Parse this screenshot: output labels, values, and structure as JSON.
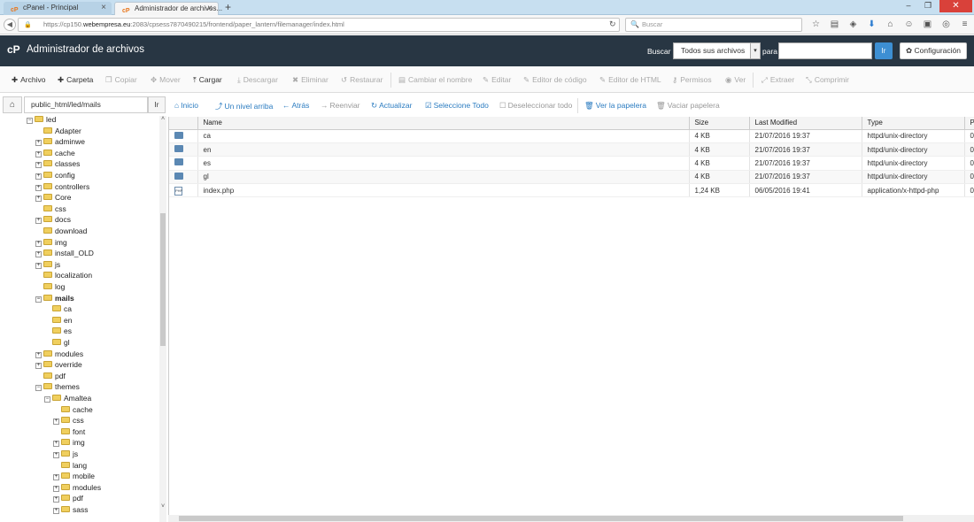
{
  "browser": {
    "tabs": [
      {
        "label": "cPanel - Principal",
        "active": false
      },
      {
        "label": "Administrador de archivos...",
        "active": true
      }
    ],
    "url_prefix": "https://cp150.",
    "url_host": "webempresa.eu",
    "url_rest": ":2083/cpsess7870490215/frontend/paper_lantern/filemanager/index.html",
    "search_placeholder": "Buscar"
  },
  "header": {
    "title": "Administrador de archivos",
    "search_label": "Buscar",
    "search_scope": "Todos sus archivos",
    "for_label": "para",
    "go_label": "Ir",
    "settings_label": "Configuración"
  },
  "toolbar": [
    {
      "label": "Archivo",
      "icon": "plus-icon",
      "enabled": true
    },
    {
      "label": "Carpeta",
      "icon": "plus-icon",
      "enabled": true
    },
    {
      "label": "Copiar",
      "icon": "copy-icon",
      "enabled": false
    },
    {
      "label": "Mover",
      "icon": "move-icon",
      "enabled": false
    },
    {
      "label": "Cargar",
      "icon": "upload-icon",
      "enabled": true
    },
    {
      "label": "Descargar",
      "icon": "download-icon",
      "enabled": false
    },
    {
      "label": "Eliminar",
      "icon": "delete-icon",
      "enabled": false
    },
    {
      "label": "Restaurar",
      "icon": "restore-icon",
      "enabled": false
    },
    {
      "label": "Cambiar el nombre",
      "icon": "rename-icon",
      "enabled": false
    },
    {
      "label": "Editar",
      "icon": "pencil-icon",
      "enabled": false
    },
    {
      "label": "Editor de código",
      "icon": "code-editor-icon",
      "enabled": false
    },
    {
      "label": "Editor de HTML",
      "icon": "html-editor-icon",
      "enabled": false
    },
    {
      "label": "Permisos",
      "icon": "key-icon",
      "enabled": false
    },
    {
      "label": "Ver",
      "icon": "eye-icon",
      "enabled": false
    },
    {
      "label": "Extraer",
      "icon": "extract-icon",
      "enabled": false
    },
    {
      "label": "Comprimir",
      "icon": "compress-icon",
      "enabled": false
    }
  ],
  "path": {
    "value": "public_html/led/mails",
    "go_label": "Ir"
  },
  "actions": [
    {
      "label": "Inicio",
      "enabled": true
    },
    {
      "label": "Un nivel arriba",
      "enabled": true
    },
    {
      "label": "Atrás",
      "enabled": true
    },
    {
      "label": "Reenviar",
      "enabled": false
    },
    {
      "label": "Actualizar",
      "enabled": true
    },
    {
      "label": "Seleccione Todo",
      "enabled": true
    },
    {
      "label": "Deseleccionar todo",
      "enabled": false
    },
    {
      "label": "Ver la papelera",
      "enabled": true
    },
    {
      "label": "Vaciar papelera",
      "enabled": false
    }
  ],
  "tree": [
    {
      "label": "led",
      "level": 0,
      "expander": "−",
      "bold": false
    },
    {
      "label": "Adapter",
      "level": 1,
      "expander": "",
      "bold": false
    },
    {
      "label": "adminwe",
      "level": 1,
      "expander": "+",
      "bold": false
    },
    {
      "label": "cache",
      "level": 1,
      "expander": "+",
      "bold": false
    },
    {
      "label": "classes",
      "level": 1,
      "expander": "+",
      "bold": false
    },
    {
      "label": "config",
      "level": 1,
      "expander": "+",
      "bold": false
    },
    {
      "label": "controllers",
      "level": 1,
      "expander": "+",
      "bold": false
    },
    {
      "label": "Core",
      "level": 1,
      "expander": "+",
      "bold": false
    },
    {
      "label": "css",
      "level": 1,
      "expander": "",
      "bold": false
    },
    {
      "label": "docs",
      "level": 1,
      "expander": "+",
      "bold": false
    },
    {
      "label": "download",
      "level": 1,
      "expander": "",
      "bold": false
    },
    {
      "label": "img",
      "level": 1,
      "expander": "+",
      "bold": false
    },
    {
      "label": "install_OLD",
      "level": 1,
      "expander": "+",
      "bold": false
    },
    {
      "label": "js",
      "level": 1,
      "expander": "+",
      "bold": false
    },
    {
      "label": "localization",
      "level": 1,
      "expander": "",
      "bold": false
    },
    {
      "label": "log",
      "level": 1,
      "expander": "",
      "bold": false
    },
    {
      "label": "mails",
      "level": 1,
      "expander": "−",
      "bold": true
    },
    {
      "label": "ca",
      "level": 2,
      "expander": "",
      "bold": false
    },
    {
      "label": "en",
      "level": 2,
      "expander": "",
      "bold": false
    },
    {
      "label": "es",
      "level": 2,
      "expander": "",
      "bold": false
    },
    {
      "label": "gl",
      "level": 2,
      "expander": "",
      "bold": false
    },
    {
      "label": "modules",
      "level": 1,
      "expander": "+",
      "bold": false
    },
    {
      "label": "override",
      "level": 1,
      "expander": "+",
      "bold": false
    },
    {
      "label": "pdf",
      "level": 1,
      "expander": "",
      "bold": false
    },
    {
      "label": "themes",
      "level": 1,
      "expander": "−",
      "bold": false
    },
    {
      "label": "Amaltea",
      "level": 2,
      "expander": "−",
      "bold": false
    },
    {
      "label": "cache",
      "level": 3,
      "expander": "",
      "bold": false
    },
    {
      "label": "css",
      "level": 3,
      "expander": "+",
      "bold": false
    },
    {
      "label": "font",
      "level": 3,
      "expander": "",
      "bold": false
    },
    {
      "label": "img",
      "level": 3,
      "expander": "+",
      "bold": false
    },
    {
      "label": "js",
      "level": 3,
      "expander": "+",
      "bold": false
    },
    {
      "label": "lang",
      "level": 3,
      "expander": "",
      "bold": false
    },
    {
      "label": "mobile",
      "level": 3,
      "expander": "+",
      "bold": false
    },
    {
      "label": "modules",
      "level": 3,
      "expander": "+",
      "bold": false
    },
    {
      "label": "pdf",
      "level": 3,
      "expander": "+",
      "bold": false
    },
    {
      "label": "sass",
      "level": 3,
      "expander": "+",
      "bold": false
    }
  ],
  "files": {
    "columns": [
      "Name",
      "Size",
      "Last Modified",
      "Type",
      "P"
    ],
    "rows": [
      {
        "icon": "folder",
        "name": "ca",
        "size": "4 KB",
        "modified": "21/07/2016 19:37",
        "type": "httpd/unix-directory",
        "perm": "0"
      },
      {
        "icon": "folder",
        "name": "en",
        "size": "4 KB",
        "modified": "21/07/2016 19:37",
        "type": "httpd/unix-directory",
        "perm": "0"
      },
      {
        "icon": "folder",
        "name": "es",
        "size": "4 KB",
        "modified": "21/07/2016 19:37",
        "type": "httpd/unix-directory",
        "perm": "0"
      },
      {
        "icon": "folder",
        "name": "gl",
        "size": "4 KB",
        "modified": "21/07/2016 19:37",
        "type": "httpd/unix-directory",
        "perm": "0"
      },
      {
        "icon": "php",
        "name": "index.php",
        "size": "1,24 KB",
        "modified": "06/05/2016 19:41",
        "type": "application/x-httpd-php",
        "perm": "0"
      }
    ]
  },
  "colors": {
    "header_bg": "#283643",
    "accent": "#3d8fd3",
    "link": "#2a7bc0"
  }
}
